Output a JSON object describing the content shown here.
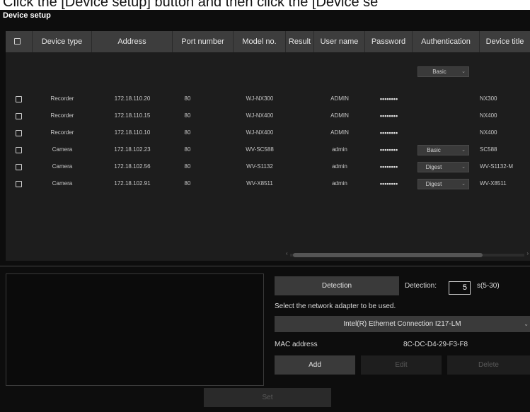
{
  "caption": "Click the [Device setup] button and then click the [Device se",
  "window": {
    "title": "Device setup"
  },
  "table": {
    "columns": [
      "Device type",
      "Address",
      "Port number",
      "Model no.",
      "Result",
      "User name",
      "Password",
      "Authentication",
      "Device title"
    ],
    "default_auth": "Basic",
    "rows": [
      {
        "type": "Recorder",
        "address": "172.18.110.20",
        "port": "80",
        "model": "WJ-NX300",
        "result": "",
        "user": "ADMIN",
        "password": "••••••••",
        "auth": "",
        "title": "NX300"
      },
      {
        "type": "Recorder",
        "address": "172.18.110.15",
        "port": "80",
        "model": "WJ-NX400",
        "result": "",
        "user": "ADMIN",
        "password": "••••••••",
        "auth": "",
        "title": "NX400"
      },
      {
        "type": "Recorder",
        "address": "172.18.110.10",
        "port": "80",
        "model": "WJ-NX400",
        "result": "",
        "user": "ADMIN",
        "password": "••••••••",
        "auth": "",
        "title": "NX400"
      },
      {
        "type": "Camera",
        "address": "172.18.102.23",
        "port": "80",
        "model": "WV-SC588",
        "result": "",
        "user": "admin",
        "password": "••••••••",
        "auth": "Basic",
        "title": "SC588"
      },
      {
        "type": "Camera",
        "address": "172.18.102.56",
        "port": "80",
        "model": "WV-S1132",
        "result": "",
        "user": "admin",
        "password": "••••••••",
        "auth": "Digest",
        "title": "WV-S1132-M"
      },
      {
        "type": "Camera",
        "address": "172.18.102.91",
        "port": "80",
        "model": "WV-X8511",
        "result": "",
        "user": "admin",
        "password": "••••••••",
        "auth": "Digest",
        "title": "WV-X8511"
      }
    ]
  },
  "detection": {
    "button": "Detection",
    "label": "Detection:",
    "seconds": "5",
    "range": "s(5-30)"
  },
  "network": {
    "label": "Select the network adapter to be used.",
    "adapter": "Intel(R) Ethernet Connection I217-LM",
    "mac_label": "MAC address",
    "mac_value": "8C-DC-D4-29-F3-F8"
  },
  "buttons": {
    "add": "Add",
    "edit": "Edit",
    "delete": "Delete",
    "set": "Set"
  }
}
